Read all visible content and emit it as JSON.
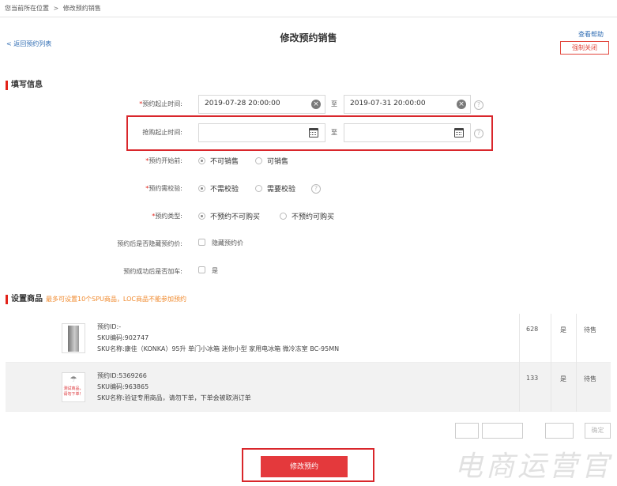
{
  "breadcrumb": {
    "prefix": "您当前所在位置",
    "separator": ">",
    "current": "修改预约销售"
  },
  "header": {
    "back": "< 返回预约列表",
    "title": "修改预约销售",
    "help": "查看帮助",
    "force_close": "强制关闭"
  },
  "sections": {
    "fill": {
      "title": "填写信息"
    },
    "goods": {
      "title": "设置商品",
      "note": "最多可设置10个SPU商品，LOC商品不能参加预约"
    }
  },
  "form": {
    "booking_time": {
      "label": "预约起止时间:",
      "start": "2019-07-28 20:00:00",
      "end": "2019-07-31 20:00:00",
      "to": "至",
      "help": "?"
    },
    "rush_time": {
      "label": "抢购起止时间:",
      "start": "",
      "end": "",
      "to": "至",
      "help": "?"
    },
    "presale": {
      "label": "预约开始前:",
      "options": [
        "不可销售",
        "可销售"
      ],
      "selected": 0
    },
    "verify": {
      "label": "预约需校验:",
      "options": [
        "不需校验",
        "需要校验"
      ],
      "selected": 0,
      "help": "?"
    },
    "type": {
      "label": "预约类型:",
      "options": [
        "不预约不可购买",
        "不预约可购买"
      ],
      "selected": 0
    },
    "hide_price": {
      "label": "预约后是否隐藏预约价:",
      "option": "隐藏预约价"
    },
    "add_cart": {
      "label": "预约成功后是否加车:",
      "option": "是"
    }
  },
  "goods": [
    {
      "id_line": "预约ID:-",
      "sku_line": "SKU编码:902747",
      "name_line": "SKU名称:康佳（KONKA）95升 单门小冰箱 迷你小型 家用电冰箱 微冷冻室 BC-95MN",
      "qty": "628",
      "flag": "是",
      "status": "待售",
      "thumb": "fridge"
    },
    {
      "id_line": "预约ID:5369266",
      "sku_line": "SKU编码:963865",
      "name_line": "SKU名称:验证专用商品，请勿下单，下单会被取消订单",
      "qty": "133",
      "flag": "是",
      "status": "待售",
      "thumb": "test",
      "thumb_text": "测试商品，请勿下单！"
    }
  ],
  "pager": {
    "faint": "确定"
  },
  "submit": {
    "label": "修改预约"
  },
  "watermark": "电商运营官",
  "colors": {
    "accent": "#e2231a",
    "link": "#2f6cb3",
    "note": "#f08a2e",
    "button": "#e4393c"
  }
}
